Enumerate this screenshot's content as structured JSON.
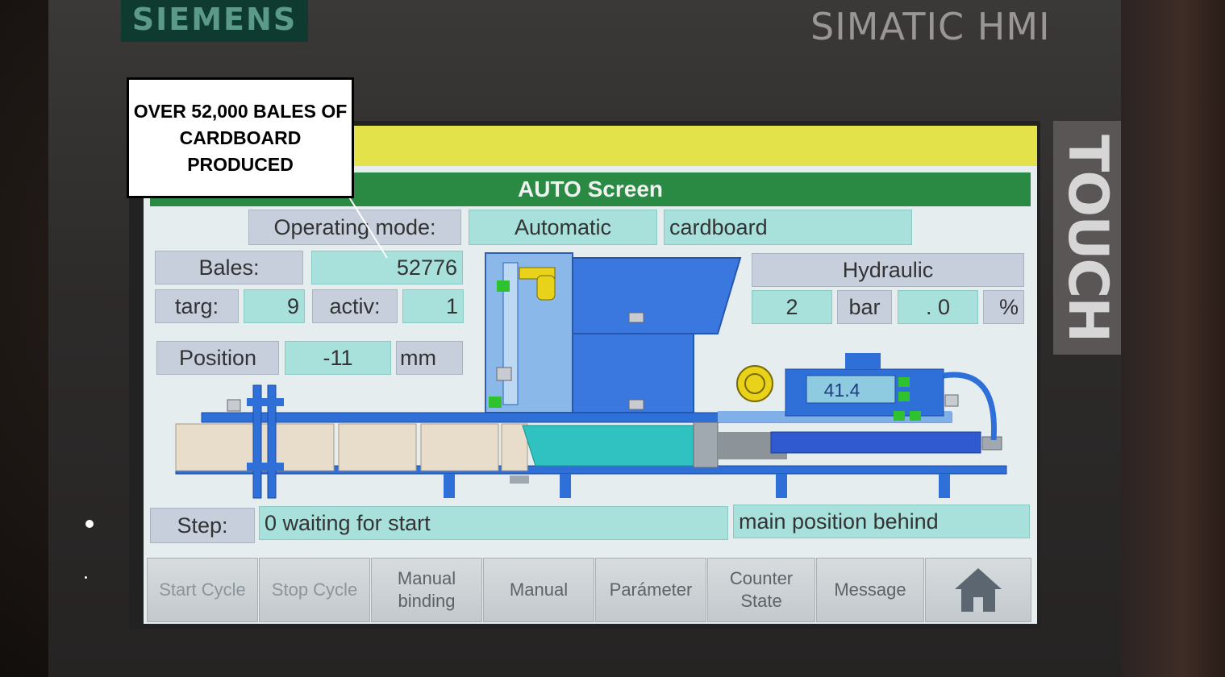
{
  "device": {
    "brand": "SIEMENS",
    "model": "SIMATIC HMI",
    "touch_label": "TOUCH"
  },
  "screen": {
    "title": "AUTO Screen",
    "operating_mode": {
      "label": "Operating mode:",
      "mode": "Automatic",
      "material": "cardboard"
    },
    "bales": {
      "label": "Bales:",
      "value": "52776"
    },
    "target": {
      "label": "targ:",
      "value": "9"
    },
    "active": {
      "label": "activ:",
      "value": "1"
    },
    "position": {
      "label": "Position",
      "value": "-11",
      "unit": "mm"
    },
    "hydraulic": {
      "label": "Hydraulic",
      "pressure": "2",
      "pressure_unit": "bar",
      "percent_value": ". 0",
      "percent_unit": "%"
    },
    "motor_readout": "41.4",
    "step": {
      "label": "Step:",
      "value": "0 waiting for start",
      "position_state": "main position behind"
    },
    "buttons": [
      {
        "label": "Start Cycle",
        "name": "start-cycle-button",
        "enabled": false
      },
      {
        "label": "Stop Cycle",
        "name": "stop-cycle-button",
        "enabled": false
      },
      {
        "label": "Manual binding",
        "name": "manual-binding-button",
        "enabled": true
      },
      {
        "label": "Manual",
        "name": "manual-button",
        "enabled": true
      },
      {
        "label": "Parámeter",
        "name": "parameter-button",
        "enabled": true
      },
      {
        "label": "Counter State",
        "name": "counter-state-button",
        "enabled": true
      },
      {
        "label": "Message",
        "name": "message-button",
        "enabled": true
      },
      {
        "label": "",
        "name": "home-button",
        "icon": "home-icon",
        "enabled": true
      }
    ]
  },
  "callout": {
    "text": "OVER 52,000 BALES OF CARDBOARD PRODUCED"
  },
  "colors": {
    "title_bar": "#2a8a44",
    "alarm_bar": "#e4e24a",
    "value_field": "#a8e0dc",
    "label_field": "#c7cfdc",
    "machine_blue": "#2f6fd8"
  }
}
